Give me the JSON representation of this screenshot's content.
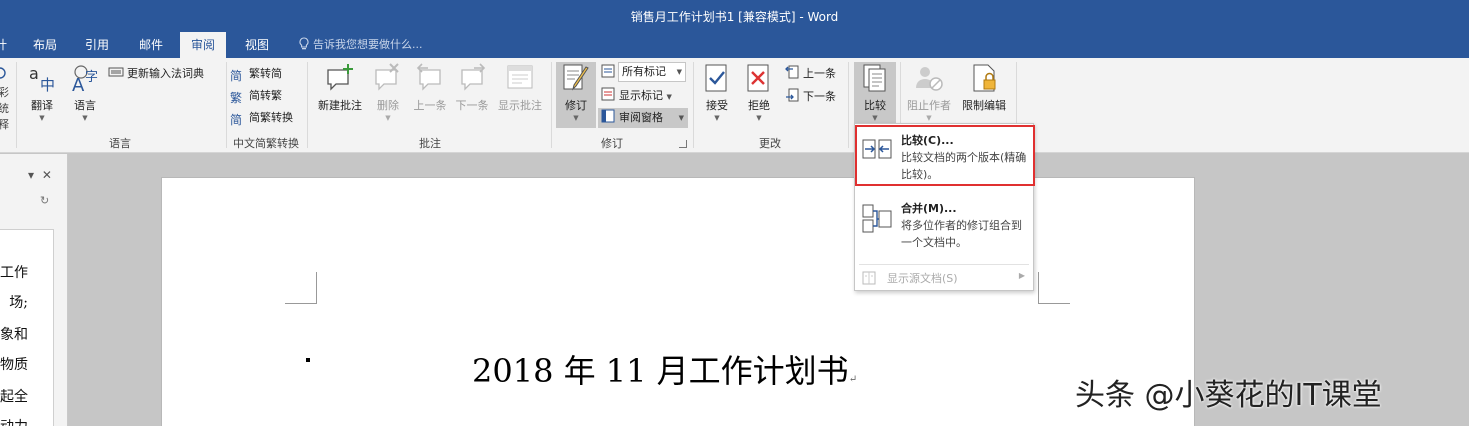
{
  "window": {
    "title": "销售月工作计划书1 [兼容模式] - Word"
  },
  "tabs": [
    {
      "label": "计"
    },
    {
      "label": "布局"
    },
    {
      "label": "引用"
    },
    {
      "label": "邮件"
    },
    {
      "label": "审阅",
      "active": true
    },
    {
      "label": "视图"
    }
  ],
  "tell_me": "告诉我您想要做什么...",
  "ribbon": {
    "language": {
      "translate": "翻译",
      "language": "语言",
      "update_ime": "更新输入法词典",
      "group_label": "语言",
      "left_cut_1": "彩",
      "left_cut_2": "统",
      "left_cut_3": "释"
    },
    "chinese_conv": {
      "to_simplified": "繁转简",
      "to_traditional": "简转繁",
      "convert": "简繁转换",
      "group_label": "中文简繁转换"
    },
    "comments": {
      "new": "新建批注",
      "delete": "删除",
      "prev": "上一条",
      "next": "下一条",
      "show": "显示批注",
      "group_label": "批注"
    },
    "tracking": {
      "track_changes": "修订",
      "all_markup": "所有标记",
      "show_markup": "显示标记",
      "review_pane": "审阅窗格",
      "group_label": "修订"
    },
    "changes": {
      "accept": "接受",
      "reject": "拒绝",
      "prev": "上一条",
      "next": "下一条",
      "group_label": "更改"
    },
    "compare": {
      "label": "比较"
    },
    "protect": {
      "block_authors": "阻止作者",
      "restrict_editing": "限制编辑"
    }
  },
  "compare_menu": {
    "compare": {
      "title": "比较(C)...",
      "desc": "比较文档的两个版本(精确比较)。"
    },
    "combine": {
      "title": "合并(M)...",
      "desc": "将多位作者的修订组合到一个文档中。"
    },
    "show_source": {
      "title": "显示源文档(S)"
    }
  },
  "left_pane": {
    "lines": [
      "工作",
      "场;",
      "象和",
      "物质",
      "起全",
      "动力"
    ]
  },
  "document": {
    "heading": "2018 年 11 月工作计划书"
  },
  "watermark": "头条 @小葵花的IT课堂",
  "colors": {
    "brand": "#2b579a",
    "highlight": "#e03030"
  }
}
